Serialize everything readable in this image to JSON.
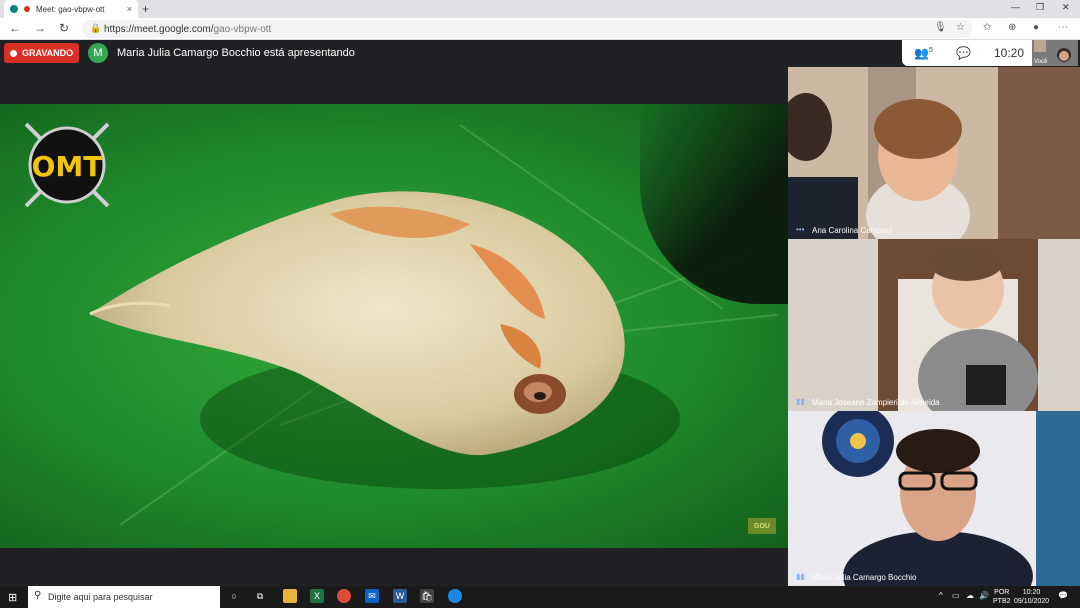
{
  "browser": {
    "tab_title": "Meet: gao-vbpw-ott",
    "tab_close": "×",
    "new_tab": "+",
    "url_host": "https://meet.google.com/",
    "url_path": "gao-vbpw-ott"
  },
  "meet": {
    "recording_label": "GRAVANDO",
    "presenter_initial": "M",
    "presenter_text": "Maria Julia Camargo Bocchio está apresentando",
    "participants_count": "5",
    "time": "10:20",
    "self_label": "Você"
  },
  "slide": {
    "logo_text": "OMT",
    "watermark": "GOU"
  },
  "participants": [
    {
      "name": "Ana Carolina Campaci"
    },
    {
      "name": "Maria Joseane Zampieri de Almeida"
    },
    {
      "name": "Maria Julia Camargo Bocchio"
    }
  ],
  "taskbar": {
    "search_placeholder": "Digite aqui para pesquisar",
    "lang_1": "POR",
    "lang_2": "PTB2",
    "clock_time": "10:20",
    "clock_date": "09/10/2020"
  },
  "colors": {
    "recording": "#d93025",
    "presenter_avatar": "#34a853",
    "meet_background": "#202124"
  }
}
